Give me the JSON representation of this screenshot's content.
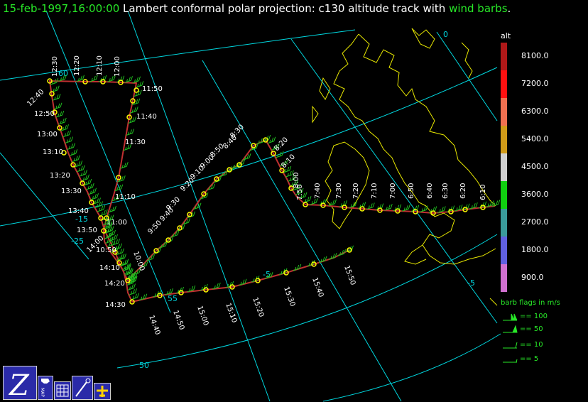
{
  "title": {
    "time": "15-feb-1997,16:00:00",
    "projection": "Lambert conformal polar projection:",
    "track": "c130 altitude track with",
    "barbs": "wind barbs",
    "end": "."
  },
  "colors": {
    "background": "#000000",
    "grid": "#00d8e0",
    "coast": "#e8e800",
    "track": "#c03030",
    "waypoint": "#ffff00",
    "barb": "#20c020",
    "title_green": "#28e828"
  },
  "grid_labels": {
    "lat_60": "60",
    "lat_55": "55",
    "lat_50": "50",
    "lon_m25": "-25",
    "lon_m15": "-15",
    "lon_m5": "-5",
    "lon_m5_lower": "-5",
    "lon_0": "0"
  },
  "altitude_legend": {
    "title": "alt",
    "ticks": [
      "8100.0",
      "7200.0",
      "6300.0",
      "5400.0",
      "4500.0",
      "3600.0",
      "2700.0",
      "1800.0",
      "900.0"
    ],
    "colors": [
      "#b01818",
      "#ff1010",
      "#f07050",
      "#d09a18",
      "#d0d0d0",
      "#10d010",
      "#3a9a9a",
      "#6060e0",
      "#d070d0"
    ]
  },
  "barb_legend": {
    "title": "barb flags in m/s",
    "entries": [
      "== 100",
      "== 50",
      "== 10",
      "== 5"
    ]
  },
  "waypoints": [
    {
      "time": "11:50"
    },
    {
      "time": "12:00"
    },
    {
      "time": "12:10"
    },
    {
      "time": "12:20"
    },
    {
      "time": "12:30"
    },
    {
      "time": "12:40"
    },
    {
      "time": "12:50"
    },
    {
      "time": "13:00"
    },
    {
      "time": "13:10"
    },
    {
      "time": "13:20"
    },
    {
      "time": "13:30"
    },
    {
      "time": "13:40"
    },
    {
      "time": "13:50"
    },
    {
      "time": "14:00"
    },
    {
      "time": "14:10"
    },
    {
      "time": "14:20"
    },
    {
      "time": "14:30"
    },
    {
      "time": "14:40"
    },
    {
      "time": "14:50"
    },
    {
      "time": "15:00"
    },
    {
      "time": "15:10"
    },
    {
      "time": "15:20"
    },
    {
      "time": "15:30"
    },
    {
      "time": "15:40"
    },
    {
      "time": "15:50"
    },
    {
      "time": "11:40"
    },
    {
      "time": "11:30"
    },
    {
      "time": "11:10"
    },
    {
      "time": "11:00"
    },
    {
      "time": "10:50"
    },
    {
      "time": "10:00"
    },
    {
      "time": "9:50"
    },
    {
      "time": "9:40"
    },
    {
      "time": "9:30"
    },
    {
      "time": "9:20"
    },
    {
      "time": "9:10"
    },
    {
      "time": "9:00"
    },
    {
      "time": "8:50"
    },
    {
      "time": "8:40"
    },
    {
      "time": "8:30"
    },
    {
      "time": "8:20"
    },
    {
      "time": "8:10"
    },
    {
      "time": "8:00"
    },
    {
      "time": "7:50"
    },
    {
      "time": "7:40"
    },
    {
      "time": "7:30"
    },
    {
      "time": "7:20"
    },
    {
      "time": "7:10"
    },
    {
      "time": "7:00"
    },
    {
      "time": "6:50"
    },
    {
      "time": "6:40"
    },
    {
      "time": "6:30"
    },
    {
      "time": "6:20"
    },
    {
      "time": "6:10"
    }
  ],
  "toolbar": {
    "buttons": [
      {
        "name": "z-tool",
        "label": "Z"
      },
      {
        "name": "map-tool",
        "label": "MAP"
      },
      {
        "name": "grid-tool",
        "label": ""
      },
      {
        "name": "pen-tool",
        "label": ""
      },
      {
        "name": "plane-tool",
        "label": ""
      }
    ]
  }
}
